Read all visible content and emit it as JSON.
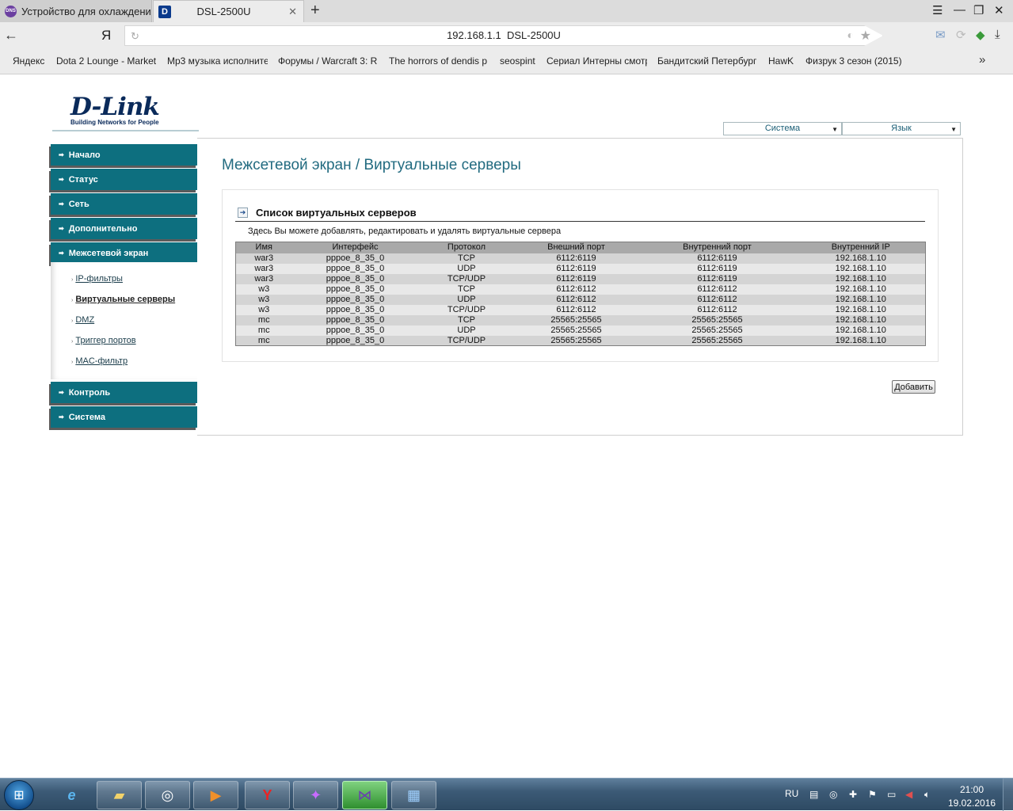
{
  "browser": {
    "tabs": [
      {
        "title": "Устройство для охлаждения",
        "favicon": "DNS"
      },
      {
        "title": "DSL-2500U",
        "favicon": "D"
      }
    ],
    "url_host": "192.168.1.1",
    "url_title": "DSL-2500U",
    "yandex_label": "Я",
    "bookmarks": [
      "Яндекс",
      "Dota 2 Lounge - Market",
      "Mp3 музыка исполните",
      "Форумы / Warcraft 3: R",
      "The horrors of dendis p",
      "seospint",
      "Сериал Интерны смотр",
      "Бандитский Петербург",
      "HawK",
      "Физрук 3 сезон (2015)"
    ]
  },
  "header": {
    "logo_word": "D-Link",
    "logo_tagline": "Building Networks for People",
    "system_select": "Система",
    "language_select": "Язык"
  },
  "sidebar": {
    "items": [
      {
        "label": "Начало"
      },
      {
        "label": "Статус"
      },
      {
        "label": "Сеть"
      },
      {
        "label": "Дополнительно"
      },
      {
        "label": "Межсетевой экран"
      },
      {
        "label": "Контроль"
      },
      {
        "label": "Система"
      }
    ],
    "submenu": [
      {
        "label": "IP-фильтры"
      },
      {
        "label": "Виртуальные серверы"
      },
      {
        "label": "DMZ"
      },
      {
        "label": "Триггер портов"
      },
      {
        "label": "MAC-фильтр"
      }
    ]
  },
  "main": {
    "title": "Межсетевой экран /  Виртуальные серверы",
    "section_title": "Список виртуальных серверов",
    "description": "Здесь Вы можете добавлять, редактировать и удалять виртуальные сервера",
    "table": {
      "headers": [
        "Имя",
        "Интерфейс",
        "Протокол",
        "Внешний порт",
        "Внутренний порт",
        "Внутренний IP"
      ],
      "rows": [
        [
          "war3",
          "pppoe_8_35_0",
          "TCP",
          "6112:6119",
          "6112:6119",
          "192.168.1.10"
        ],
        [
          "war3",
          "pppoe_8_35_0",
          "UDP",
          "6112:6119",
          "6112:6119",
          "192.168.1.10"
        ],
        [
          "war3",
          "pppoe_8_35_0",
          "TCP/UDP",
          "6112:6119",
          "6112:6119",
          "192.168.1.10"
        ],
        [
          "w3",
          "pppoe_8_35_0",
          "TCP",
          "6112:6112",
          "6112:6112",
          "192.168.1.10"
        ],
        [
          "w3",
          "pppoe_8_35_0",
          "UDP",
          "6112:6112",
          "6112:6112",
          "192.168.1.10"
        ],
        [
          "w3",
          "pppoe_8_35_0",
          "TCP/UDP",
          "6112:6112",
          "6112:6112",
          "192.168.1.10"
        ],
        [
          "mc",
          "pppoe_8_35_0",
          "TCP",
          "25565:25565",
          "25565:25565",
          "192.168.1.10"
        ],
        [
          "mc",
          "pppoe_8_35_0",
          "UDP",
          "25565:25565",
          "25565:25565",
          "192.168.1.10"
        ],
        [
          "mc",
          "pppoe_8_35_0",
          "TCP/UDP",
          "25565:25565",
          "25565:25565",
          "192.168.1.10"
        ]
      ]
    },
    "add_button": "Добавить"
  },
  "taskbar": {
    "apps": [
      "internet-explorer",
      "file-explorer",
      "steam",
      "media-player",
      "yandex-browser",
      "game-launcher",
      "visual-studio",
      "control-panel"
    ],
    "language": "RU",
    "time": "21:00",
    "date": "19.02.2016"
  },
  "colors": {
    "nav_teal": "#0d6f7f",
    "title_teal": "#226b80",
    "logo_blue": "#0a2a5a"
  }
}
